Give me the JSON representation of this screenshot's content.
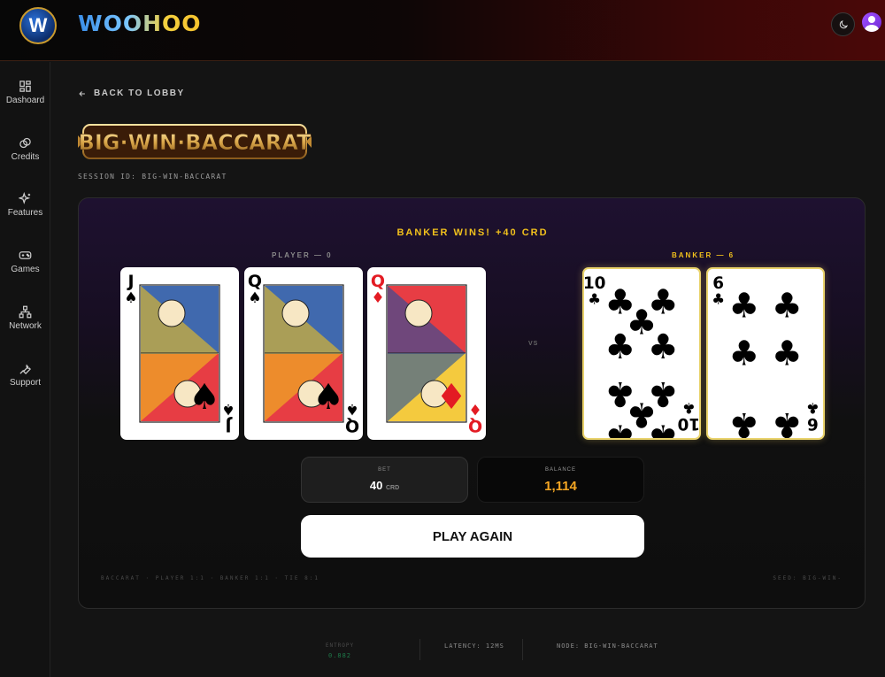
{
  "header": {
    "logo_letter": "W",
    "brand": "WOOHOO"
  },
  "sidebar": {
    "items": [
      {
        "label": "Dashoard",
        "icon": "grid-icon"
      },
      {
        "label": "Credits",
        "icon": "coins-icon"
      },
      {
        "label": "Features",
        "icon": "sparkles-icon"
      },
      {
        "label": "Games",
        "icon": "gamepad-icon"
      },
      {
        "label": "Network",
        "icon": "network-icon"
      },
      {
        "label": "Support",
        "icon": "wrench-icon"
      }
    ]
  },
  "nav": {
    "back_label": "BACK TO LOBBY"
  },
  "game": {
    "title": "BIG·WIN·BACCARAT",
    "session_id": "SESSION ID: BIG-WIN-BACCARAT"
  },
  "table": {
    "result": "BANKER WINS! +40 CRD",
    "player_label": "PLAYER — 0",
    "banker_label": "BANKER — 6",
    "vs": "VS",
    "player_cards": [
      {
        "rank": "J",
        "suit": "♠",
        "color": "#000000"
      },
      {
        "rank": "Q",
        "suit": "♠",
        "color": "#000000"
      },
      {
        "rank": "Q",
        "suit": "♦",
        "color": "#e31b23"
      }
    ],
    "banker_cards": [
      {
        "rank": "10",
        "suit": "♣",
        "color": "#000000"
      },
      {
        "rank": "6",
        "suit": "♣",
        "color": "#000000"
      }
    ],
    "bet_label": "BET",
    "bet_value": "40",
    "bet_unit": "CRD",
    "balance_label": "BALANCE",
    "balance_value": "1,114",
    "play_again": "PLAY AGAIN",
    "footer_left": "BACCARAT · PLAYER 1:1 · BANKER 1:1 · TIE 8:1",
    "footer_right": "SEED: BIG-WIN-"
  },
  "status": {
    "entropy_label": "ENTROPY",
    "entropy_value": "0.882",
    "latency": "LATENCY: 12MS",
    "node": "NODE: BIG-WIN-BACCARAT"
  },
  "colors": {
    "gold": "#f2c11c",
    "balance": "#f5a623",
    "banker_gold": "#e9d26a",
    "entropy_green": "#1e7a4a"
  }
}
